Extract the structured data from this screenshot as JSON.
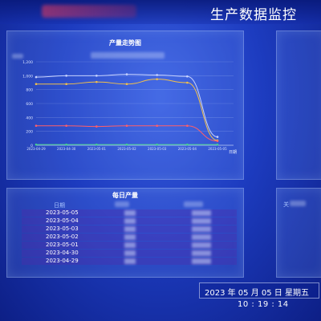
{
  "page_title": "生产数据监控",
  "trend_panel": {
    "title": "产量走势图"
  },
  "table_panel": {
    "title": "每日产量",
    "date_header": "日期",
    "rows": [
      {
        "date": "2023-05-05"
      },
      {
        "date": "2023-05-04"
      },
      {
        "date": "2023-05-03"
      },
      {
        "date": "2023-05-02"
      },
      {
        "date": "2023-05-01"
      },
      {
        "date": "2023-04-30"
      },
      {
        "date": "2023-04-29"
      }
    ]
  },
  "right_panel": {
    "header_partial": "关"
  },
  "datetime": {
    "date": "2023 年 05 月 05 日 星期五",
    "time": "10 : 19 : 14"
  },
  "chart_data": {
    "type": "line",
    "title": "产量走势图",
    "categories": [
      "2023-04-29",
      "2023-04-30",
      "2023-05-01",
      "2023-05-02",
      "2023-05-03",
      "2023-05-04",
      "2023-05-05"
    ],
    "xlabel": "日期",
    "ylabel": "",
    "ylim": [
      0,
      1200
    ],
    "yticks": [
      "0",
      "200",
      "400",
      "600",
      "800",
      "1,000",
      "1,200"
    ],
    "grid": true,
    "series": [
      {
        "color": "#c7d2ff",
        "values": [
          980,
          1000,
          1000,
          1020,
          1010,
          990,
          120
        ]
      },
      {
        "color": "#f2c04a",
        "values": [
          880,
          880,
          910,
          880,
          950,
          900,
          70
        ]
      },
      {
        "color": "#ff5e6a",
        "values": [
          280,
          280,
          270,
          280,
          280,
          280,
          60
        ]
      },
      {
        "color": "#45d18f",
        "values": [
          10,
          10,
          10,
          10,
          10,
          10,
          10
        ]
      }
    ]
  }
}
